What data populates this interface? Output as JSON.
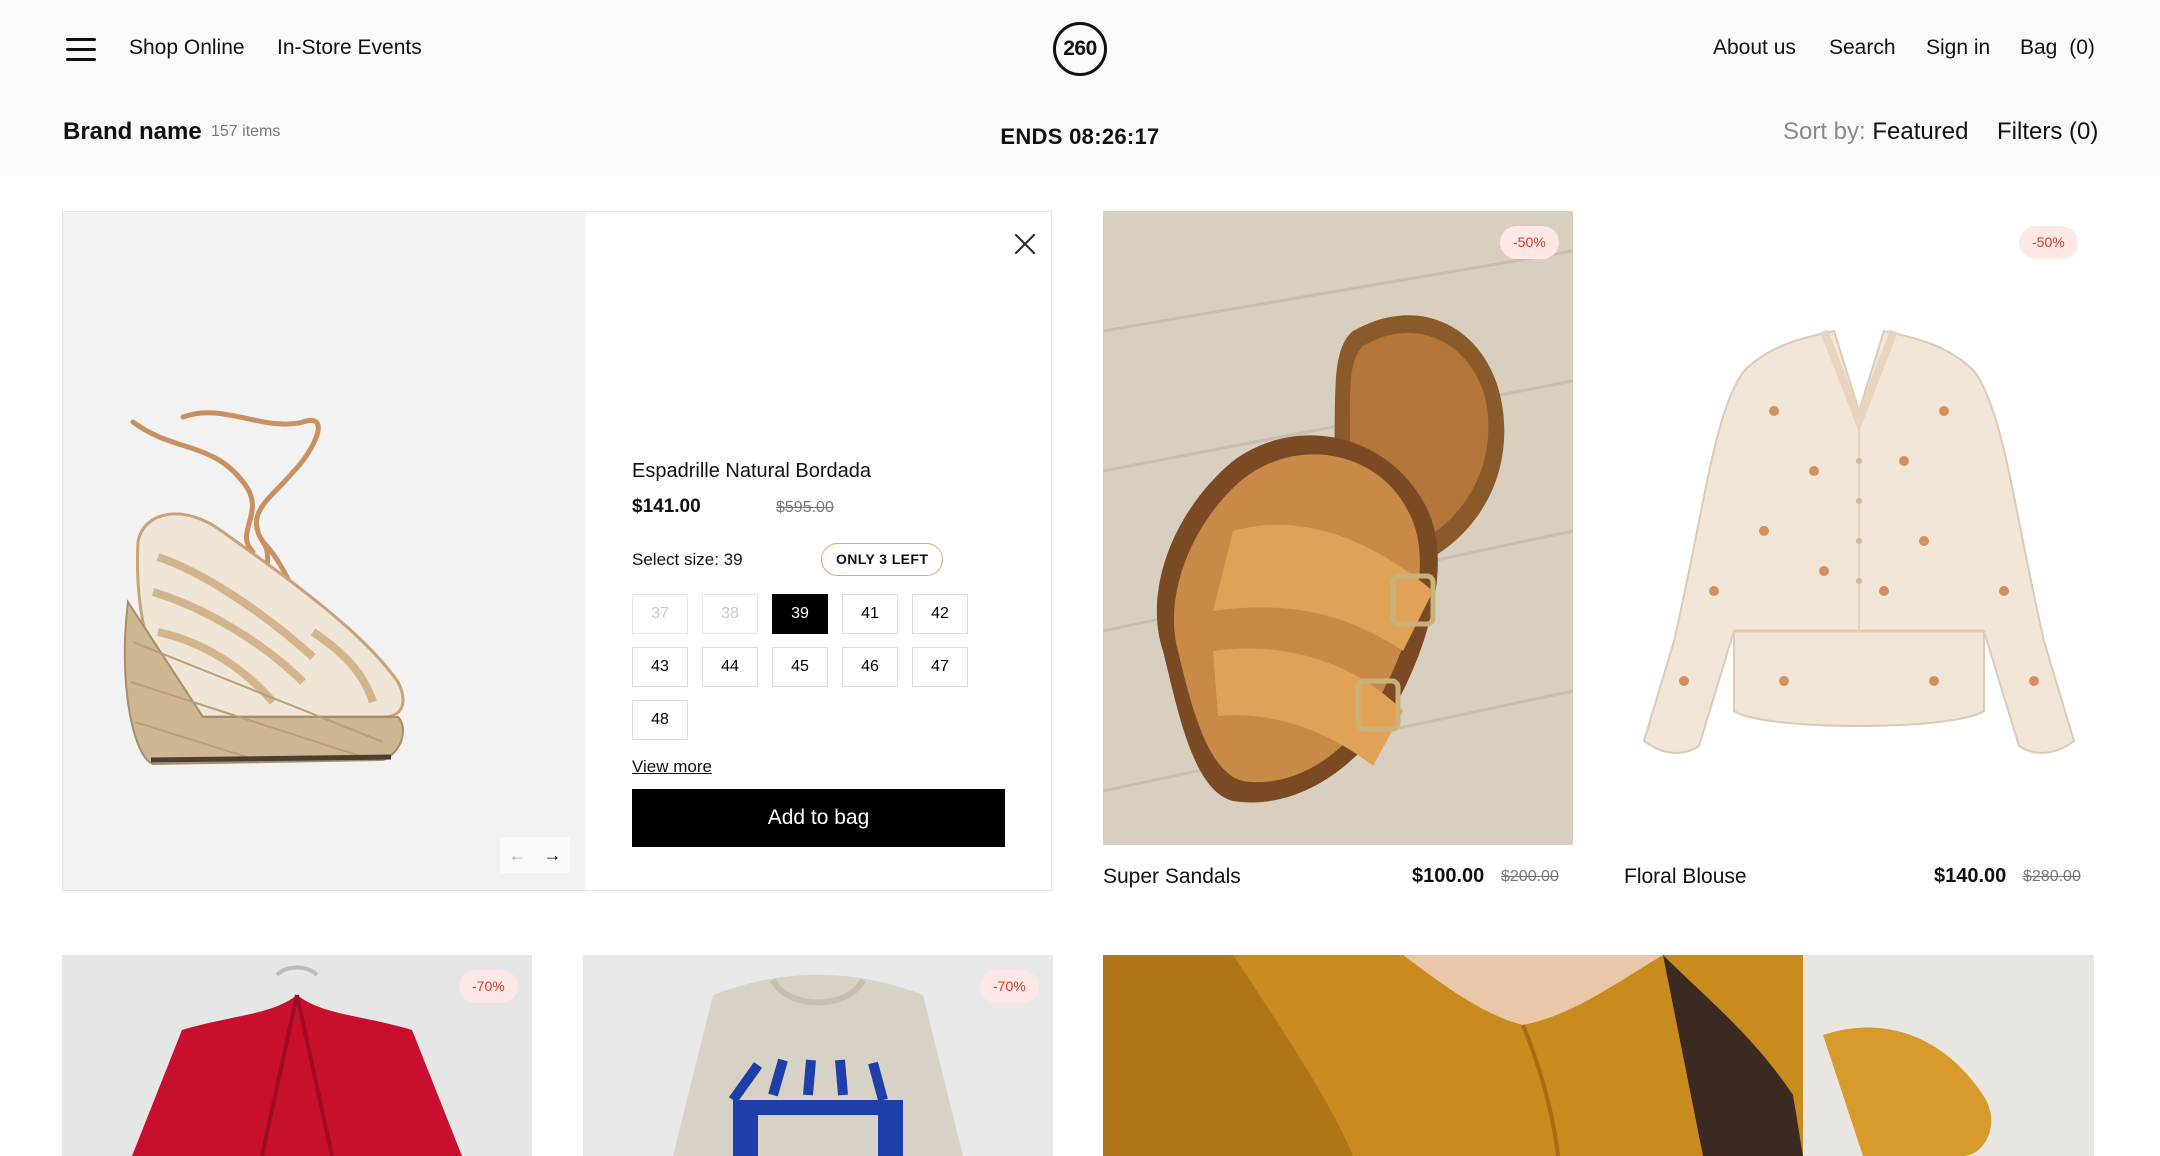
{
  "header": {
    "nav_left": [
      "Shop Online",
      "In-Store Events"
    ],
    "logo": "260",
    "nav_right": [
      "About us",
      "Search",
      "Sign in"
    ],
    "bag_label": "Bag",
    "bag_count": "(0)"
  },
  "listing": {
    "brand": "Brand name",
    "item_count": "157 items",
    "countdown": "ENDS 08:26:17",
    "sort_label": "Sort by:",
    "sort_value": "Featured",
    "filters_label": "Filters (0)"
  },
  "quick_view": {
    "title": "Espadrille Natural Bordada",
    "price": "$141.00",
    "old_price": "$595.00",
    "size_label": "Select size: 39",
    "stock_badge": "ONLY 3 LEFT",
    "sizes": [
      {
        "label": "37",
        "state": "disabled"
      },
      {
        "label": "38",
        "state": "disabled"
      },
      {
        "label": "39",
        "state": "selected"
      },
      {
        "label": "41",
        "state": "available"
      },
      {
        "label": "42",
        "state": "available"
      },
      {
        "label": "43",
        "state": "available"
      },
      {
        "label": "44",
        "state": "available"
      },
      {
        "label": "45",
        "state": "available"
      },
      {
        "label": "46",
        "state": "available"
      },
      {
        "label": "47",
        "state": "available"
      },
      {
        "label": "48",
        "state": "available"
      }
    ],
    "view_more": "View more",
    "add_to_bag": "Add to bag",
    "prev_arrow": "←",
    "next_arrow": "→"
  },
  "products": [
    {
      "name": "Super Sandals",
      "price": "$100.00",
      "old_price": "$200.00",
      "discount": "-50%"
    },
    {
      "name": "Floral Blouse",
      "price": "$140.00",
      "old_price": "$280.00",
      "discount": "-50%"
    },
    {
      "name": "",
      "price": "",
      "old_price": "",
      "discount": "-70%"
    },
    {
      "name": "",
      "price": "",
      "old_price": "",
      "discount": "-70%"
    }
  ],
  "colors": {
    "header_bg": "#fbfaf8",
    "badge_bg": "#fde8e6",
    "badge_text": "#d63a2d",
    "stock_badge_border": "#e8a468",
    "primary_button": "#000000"
  }
}
